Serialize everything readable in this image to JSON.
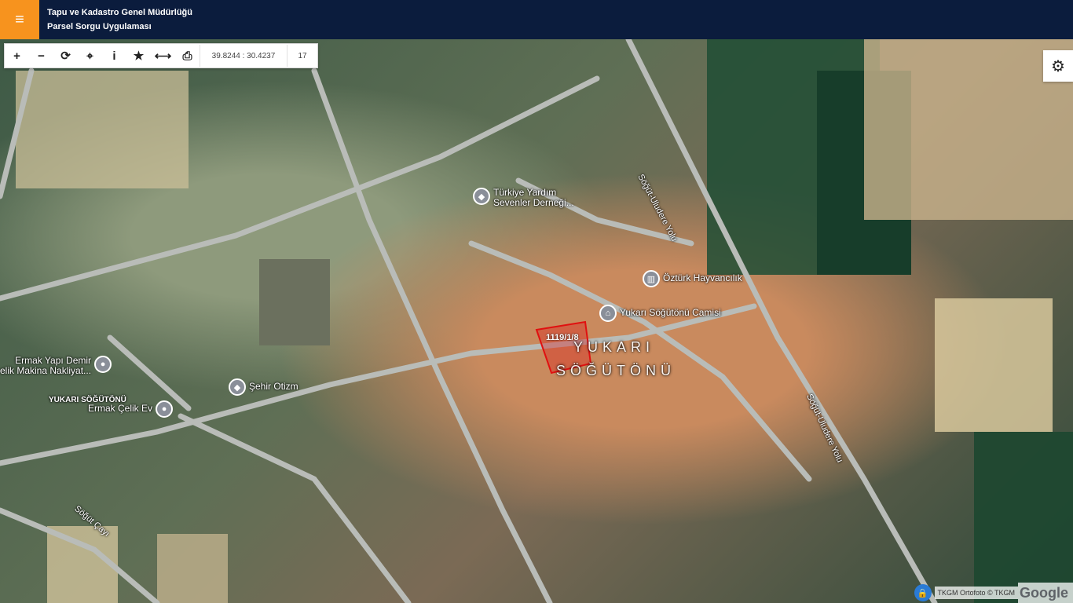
{
  "header": {
    "menu_icon": "hamburger-icon",
    "title_line1": "Tapu ve Kadastro Genel Müdürlüğü",
    "title_line2": "Parsel Sorgu Uygulaması",
    "color_bg": "#0b1c3d",
    "color_menu": "#f7931e"
  },
  "toolbar": {
    "buttons": [
      {
        "name": "zoom-in-icon",
        "glyph": "+"
      },
      {
        "name": "zoom-out-icon",
        "glyph": "−"
      },
      {
        "name": "refresh-icon",
        "glyph": "⟳"
      },
      {
        "name": "locate-icon",
        "glyph": "⌖"
      },
      {
        "name": "info-icon",
        "glyph": "i"
      },
      {
        "name": "star-icon",
        "glyph": "★"
      },
      {
        "name": "measure-icon",
        "glyph": "⟷"
      },
      {
        "name": "print-icon",
        "glyph": "⎙"
      }
    ],
    "coordinates": "39.8244 : 30.4237",
    "zoom_level": "17"
  },
  "settings": {
    "icon": "gear-icon",
    "glyph": "⚙"
  },
  "map": {
    "pois": [
      {
        "name": "turkiye-yardim",
        "line1": "Türkiye Yardım",
        "line2": "Sevenler Derneği..."
      },
      {
        "name": "ozturk-hayvancilik",
        "line1": "Öztürk Hayvancılık",
        "line2": ""
      },
      {
        "name": "yukari-sogutonu-camisi",
        "line1": "Yukarı Söğütönü Camisi",
        "line2": ""
      },
      {
        "name": "ermak-yapi",
        "line1": "Ermak Yapı Demir",
        "line2": "elik Makina Nakliyat..."
      },
      {
        "name": "sehir-otizm",
        "line1": "Şehir Otizm",
        "line2": ""
      },
      {
        "name": "ermak-celik",
        "line1": "Ermak Çelik Ev",
        "line2": ""
      }
    ],
    "roads": {
      "road1": "Söğüt-Uludere Yolu",
      "road2": "Söğüt-Uludere Yolu",
      "stream": "Söğüt Çayı"
    },
    "area_label_line1": "YUKARI",
    "area_label_line2": "SÖĞÜTÖNÜ",
    "small_area_label": "YUKARI SÖĞÜTÖNÜ",
    "parcel_label": "1119/1/8"
  },
  "attribution": {
    "lock_icon": "lock-icon",
    "text": "TKGM Ortofoto © TKGM",
    "logo": "Google"
  }
}
